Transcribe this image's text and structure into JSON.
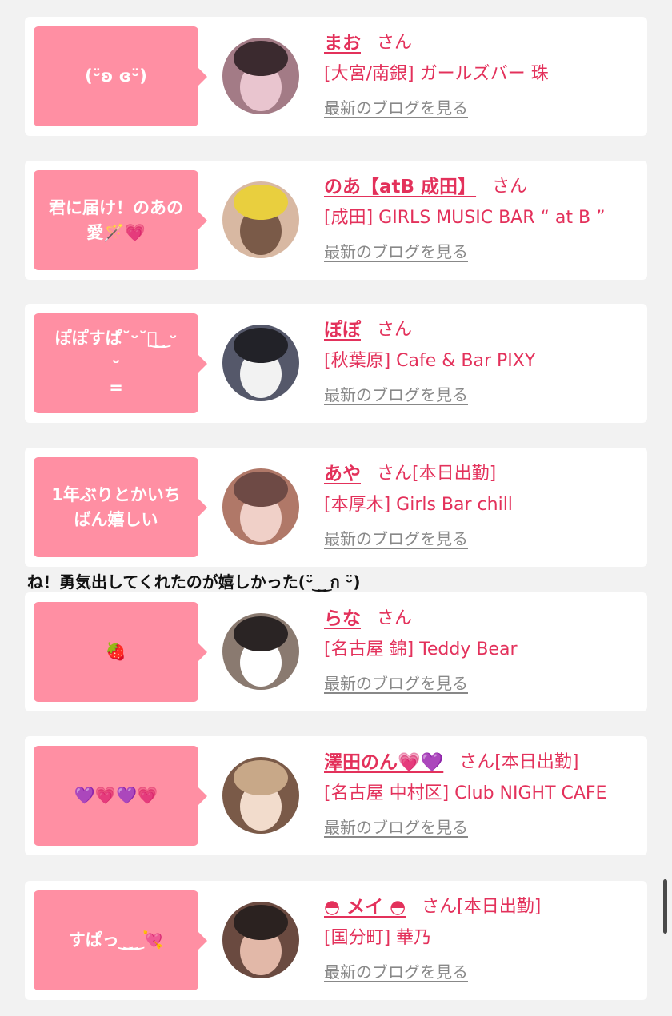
{
  "entries": [
    {
      "bubble": "(ᵕ̈ʚ ɞᵕ̈)",
      "name": "まお",
      "san": "さん",
      "today": "",
      "shop": "[大宮/南銀] ガールズバー 珠",
      "blog_link": "最新のブログを見る",
      "avatar_colors": [
        "#3b2a2f",
        "#e9c5cf",
        "#a37b86"
      ]
    },
    {
      "bubble": "君に届け！のあの\n愛🪄💗",
      "name": "のあ【atB 成田】",
      "san": "さん",
      "today": "",
      "shop": "[成田] GIRLS MUSIC BAR “ at B ”",
      "blog_link": "最新のブログを見る",
      "avatar_colors": [
        "#e9cf3e",
        "#7a5a48",
        "#d8b8a2"
      ]
    },
    {
      "bubble": "ぽぽすぱ˘ᵕ˘つ͜ ͜ ᵕ\nᵕ\n=",
      "name": "ぽぽ",
      "san": "さん",
      "today": "",
      "shop": "[秋葉原] Cafe & Bar PIXY",
      "blog_link": "最新のブログを見る",
      "avatar_colors": [
        "#222228",
        "#f2f2f2",
        "#55586a"
      ]
    },
    {
      "bubble": "1年ぶりとかいち\nばん嬉しい",
      "name": "あや",
      "san": "さん",
      "today": "[本日出勤]",
      "shop": "[本厚木] Girls Bar chill",
      "blog_link": "最新のブログを見る",
      "avatar_colors": [
        "#6e4a45",
        "#f0d0c8",
        "#b07868"
      ]
    },
    {
      "bubble": "🍓",
      "name": "らな",
      "san": "さん",
      "today": "",
      "shop": "[名古屋 錦] Teddy Bear",
      "blog_link": "最新のブログを見る",
      "avatar_colors": [
        "#2a2424",
        "#ffffff",
        "#8a7a70"
      ]
    },
    {
      "bubble": "💜💗💜💗",
      "name": "澤田のん💗💜",
      "san": "さん",
      "today": "[本日出勤]",
      "shop": "[名古屋 中村区] Club NIGHT CAFE",
      "blog_link": "最新のブログを見る",
      "avatar_colors": [
        "#c8a888",
        "#f2dccc",
        "#7a5a48"
      ]
    },
    {
      "bubble": "すぱっ ͜ ͜ ͜ 💘",
      "name": "◓ メイ ◓",
      "san": "さん",
      "today": "[本日出勤]",
      "shop": "[国分町] 華乃",
      "blog_link": "最新のブログを見る",
      "avatar_colors": [
        "#2b2220",
        "#e2b8a8",
        "#6a4a40"
      ]
    }
  ],
  "overflow_text": "ね！勇気出してくれたのが嬉しかった(ᵕ̈ ͜ ͜ ก ᵕ̈)"
}
